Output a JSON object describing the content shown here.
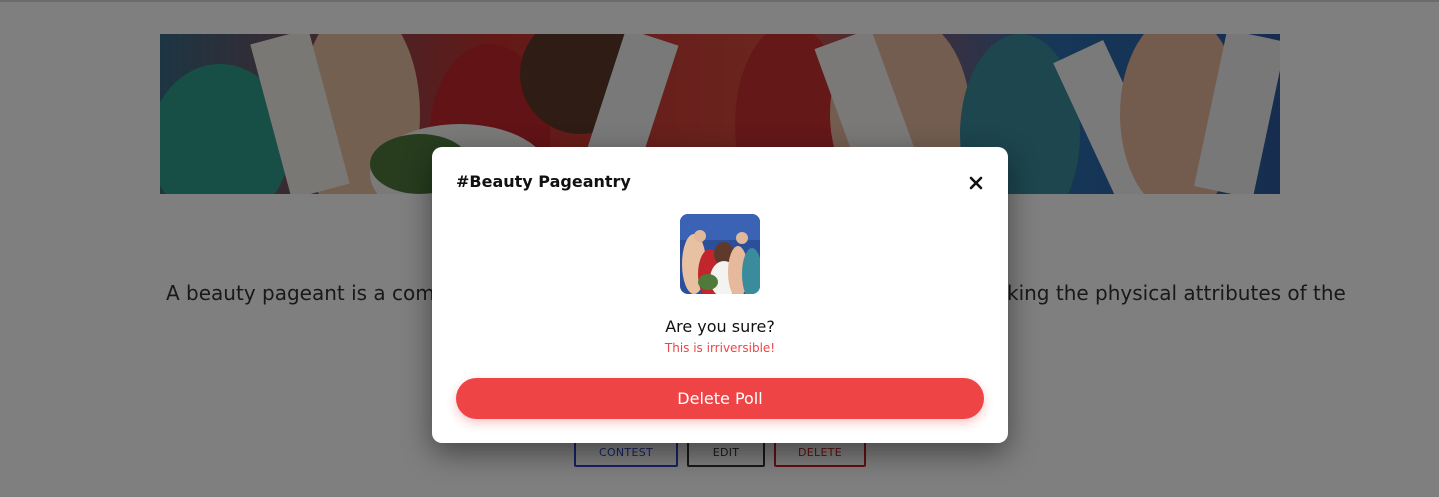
{
  "page": {
    "description": "A beauty pageant is a competition that has traditionally focused on judging and ranking the physical attributes of the",
    "actions": {
      "contest_label": "CONTEST",
      "edit_label": "EDIT",
      "delete_label": "DELETE"
    }
  },
  "modal": {
    "title": "#Beauty Pageantry",
    "question": "Are you sure?",
    "warning": "This is irriversible!",
    "delete_button": "Delete Poll",
    "close_icon": "close-icon"
  },
  "colors": {
    "danger": "#ef4446",
    "contest_border": "#2f47c8",
    "overlay": "rgba(0,0,0,0.5)"
  }
}
